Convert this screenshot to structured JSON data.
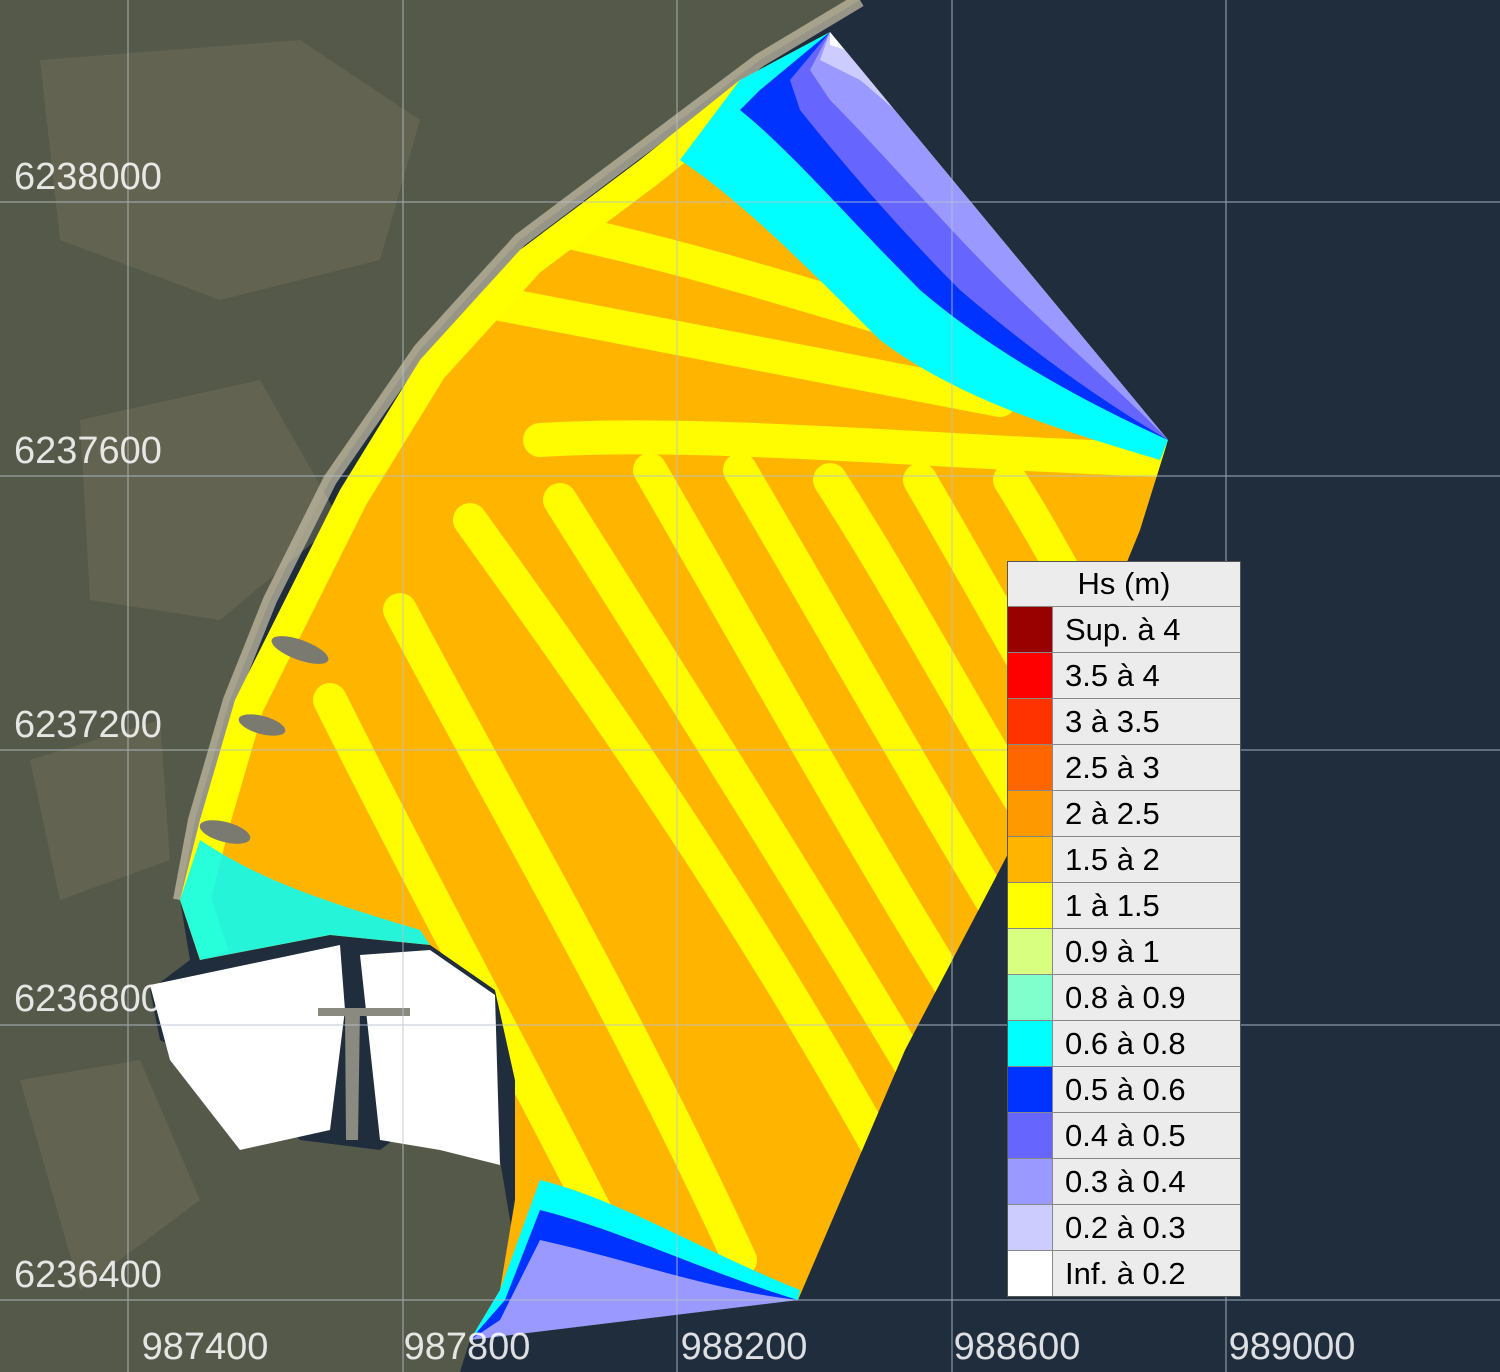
{
  "colors": {
    "sea": "#1f2d3d",
    "land": "#55594a",
    "grid": "#b8c2cc"
  },
  "y_labels": [
    "6238000",
    "6237600",
    "6237200",
    "6236800",
    "6236400"
  ],
  "x_labels": [
    "987400",
    "987800",
    "988200",
    "988600",
    "989000"
  ],
  "legend": {
    "title": "Hs (m)",
    "items": [
      {
        "label": "Sup. à 4",
        "color": "#990000"
      },
      {
        "label": "3.5 à 4",
        "color": "#ff0000"
      },
      {
        "label": "3 à 3.5",
        "color": "#ff3300"
      },
      {
        "label": "2.5 à 3",
        "color": "#ff6600"
      },
      {
        "label": "2 à 2.5",
        "color": "#ff9900"
      },
      {
        "label": "1.5 à 2",
        "color": "#ffb400"
      },
      {
        "label": "1 à 1.5",
        "color": "#ffff00"
      },
      {
        "label": "0.9 à 1",
        "color": "#d9ff80"
      },
      {
        "label": "0.8 à 0.9",
        "color": "#80ffcc"
      },
      {
        "label": "0.6 à 0.8",
        "color": "#00ffff"
      },
      {
        "label": "0.5 à 0.6",
        "color": "#0033ff"
      },
      {
        "label": "0.4 à 0.5",
        "color": "#6666ff"
      },
      {
        "label": "0.3 à 0.4",
        "color": "#9999ff"
      },
      {
        "label": "0.2 à 0.3",
        "color": "#ccccff"
      },
      {
        "label": "Inf. à 0.2",
        "color": "#ffffff"
      }
    ]
  }
}
